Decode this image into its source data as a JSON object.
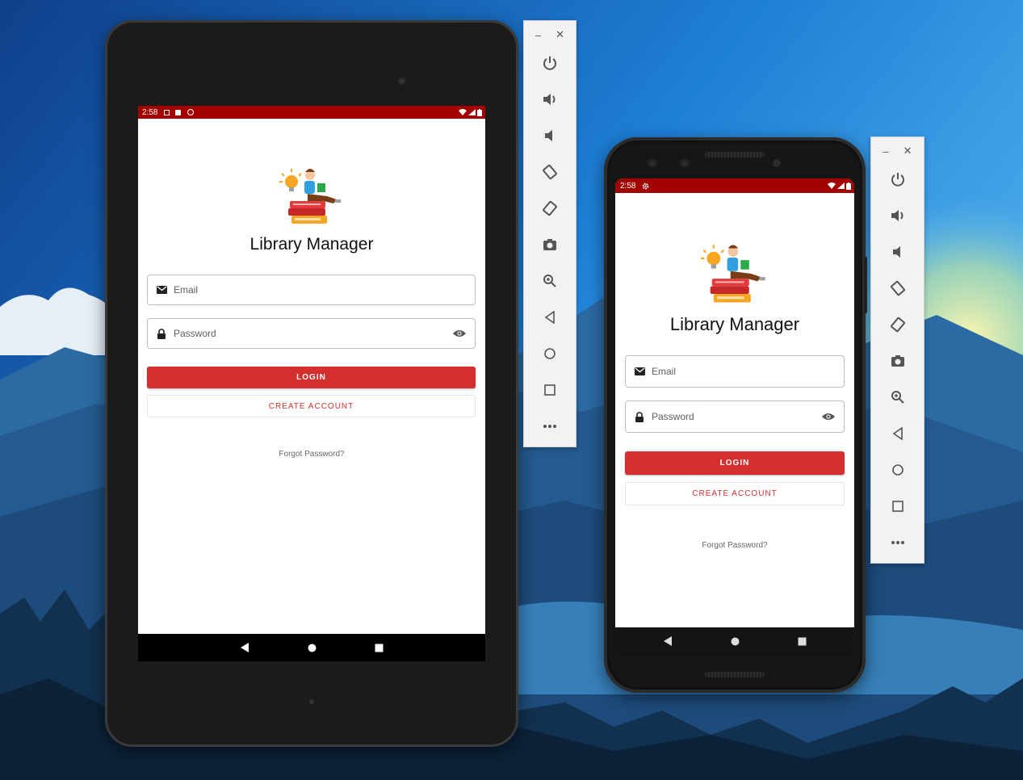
{
  "app": {
    "title": "Library Manager",
    "email_placeholder": "Email",
    "password_placeholder": "Password",
    "login_label": "LOGIN",
    "create_account_label": "CREATE ACCOUNT",
    "forgot_password_label": "Forgot Password?",
    "accent_color": "#d32f2f",
    "status_bar_color": "#a30000"
  },
  "tablet": {
    "status_time": "2:58",
    "status_icons": [
      "notification-icon",
      "sd-card-icon",
      "sync-icon"
    ],
    "status_right_icons": [
      "wifi-icon",
      "signal-icon",
      "battery-icon"
    ]
  },
  "phone": {
    "status_time": "2:58",
    "status_icons": [
      "settings-gear-icon"
    ],
    "status_right_icons": [
      "wifi-icon",
      "signal-icon",
      "battery-icon"
    ]
  },
  "emulator_toolbar": {
    "window_controls": [
      "minimize-icon",
      "close-icon"
    ],
    "minimize_glyph": "–",
    "close_glyph": "✕",
    "items": [
      "power-icon",
      "volume-up-icon",
      "volume-down-icon",
      "rotate-left-icon",
      "rotate-right-icon",
      "camera-icon",
      "zoom-icon",
      "back-icon",
      "home-icon",
      "overview-icon",
      "more-icon"
    ]
  },
  "nav_buttons": [
    "back-icon",
    "home-icon",
    "recents-icon"
  ]
}
